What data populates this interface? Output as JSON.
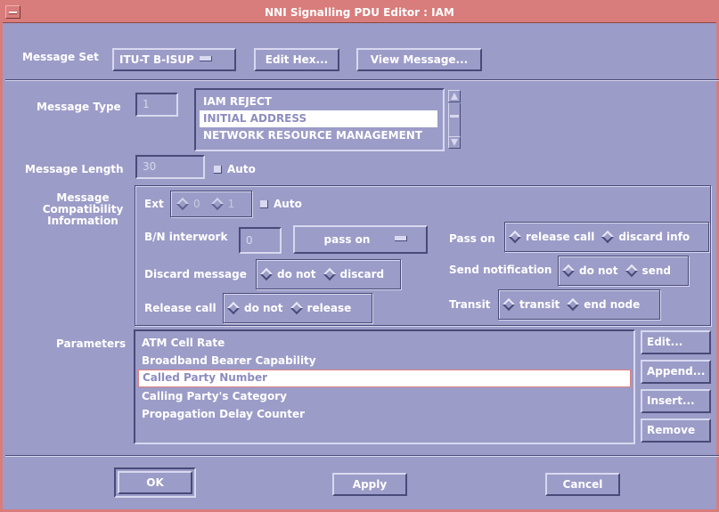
{
  "window": {
    "title": "NNI Signalling PDU Editor : IAM"
  },
  "message_set": {
    "label": "Message Set",
    "selected": "ITU-T B-ISUP",
    "edit_hex_label": "Edit Hex...",
    "view_message_label": "View Message..."
  },
  "message_type": {
    "label": "Message Type",
    "value": "1",
    "options": [
      "IAM REJECT",
      "INITIAL ADDRESS",
      "NETWORK RESOURCE MANAGEMENT"
    ],
    "selected_index": 1
  },
  "message_length": {
    "label": "Message Length",
    "value": "30",
    "auto_label": "Auto"
  },
  "mci": {
    "label_line1": "Message",
    "label_line2": "Compatibility",
    "label_line3": "Information",
    "ext_label": "Ext",
    "ext_opt0": "0",
    "ext_opt1": "1",
    "auto_label": "Auto",
    "bn_interwork_label": "B/N interwork",
    "bn_interwork_value": "0",
    "bn_interwork_option": "pass on",
    "pass_on_label": "Pass on",
    "pass_on_opt1": "release call",
    "pass_on_opt2": "discard info",
    "discard_message_label": "Discard message",
    "discard_opt1": "do not",
    "discard_opt2": "discard",
    "send_notification_label": "Send notification",
    "send_opt1": "do not",
    "send_opt2": "send",
    "release_call_label": "Release call",
    "release_opt1": "do not",
    "release_opt2": "release",
    "transit_label": "Transit",
    "transit_opt1": "transit",
    "transit_opt2": "end node"
  },
  "parameters": {
    "label": "Parameters",
    "items": [
      "ATM Cell Rate",
      "Broadband Bearer Capability",
      "Called Party Number",
      "Calling Party's Category",
      "Propagation Delay Counter"
    ],
    "selected_index": 2,
    "edit_label": "Edit...",
    "append_label": "Append...",
    "insert_label": "Insert...",
    "remove_label": "Remove"
  },
  "footer": {
    "ok_label": "OK",
    "apply_label": "Apply",
    "cancel_label": "Cancel"
  },
  "colors": {
    "background": "#9c9cc8",
    "titlebar": "#d97c7c",
    "selection": "#ffffff"
  }
}
